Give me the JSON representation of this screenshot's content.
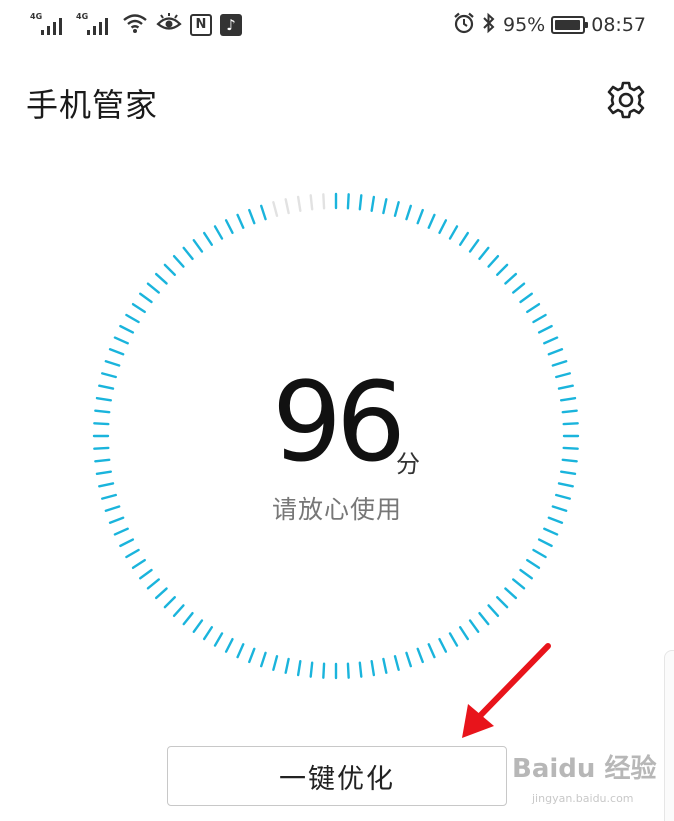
{
  "status_bar": {
    "signal_tag_1": "4G",
    "signal_tag_2": "4G",
    "nfc_label": "N",
    "battery_percent": "95%",
    "battery_level": 0.95,
    "time": "08:57",
    "icons": [
      "signal-4g-icon",
      "signal-4g-icon",
      "wifi-icon",
      "eye-comfort-icon",
      "nfc-icon",
      "tiktok-icon",
      "alarm-icon",
      "bluetooth-icon",
      "battery-icon"
    ]
  },
  "header": {
    "title": "手机管家",
    "settings_icon": "gear-icon"
  },
  "gauge": {
    "score": "96",
    "unit": "分",
    "status": "请放心使用",
    "score_fraction": 0.96,
    "accent_color": "#1ab4dc",
    "inactive_color": "#e2e2e2"
  },
  "actions": {
    "optimize_label": "一键优化"
  },
  "annotation": {
    "arrow_color": "#e8141b"
  },
  "watermark": {
    "text": "Baidu 经验",
    "url": "jingyan.baidu.com"
  }
}
